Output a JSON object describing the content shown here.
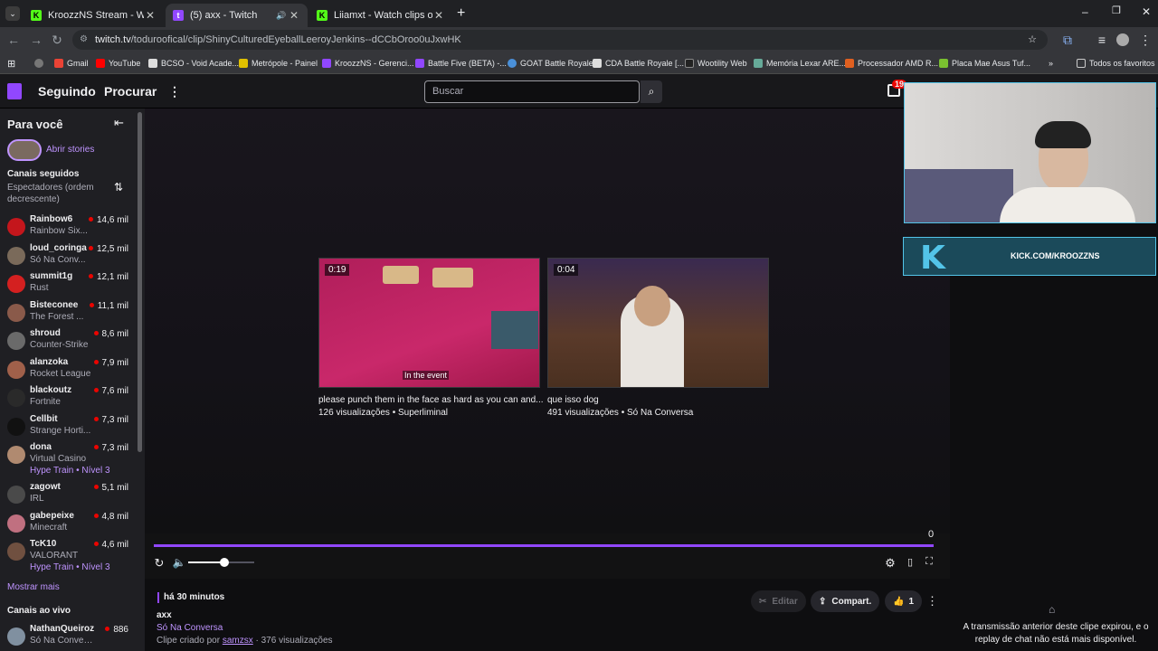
{
  "browser": {
    "tabs": [
      {
        "title": "KroozzNS Stream - Watch Live",
        "favicon": "kick-icon"
      },
      {
        "title": "(5) axx - Twitch",
        "favicon": "twitch-icon"
      },
      {
        "title": "Liiamxt - Watch clips on Kick",
        "favicon": "kick-icon"
      }
    ],
    "url_host": "twitch.tv",
    "url_path": "/toduroofical/clip/ShinyCulturedEyeballLeeroyJenkins--dCCbOroo0uJxwHK",
    "bookmarks": [
      "Gmail",
      "YouTube",
      "BCSO - Void Acade...",
      "Metrópole - Painel",
      "KroozzNS - Gerenci...",
      "Battle Five (BETA) -...",
      "GOAT Battle Royale",
      "CDA Battle Royale [...",
      "Wootility Web",
      "Memória Lexar ARE...",
      "Processador AMD R...",
      "Placa Mae Asus Tuf..."
    ],
    "all_bookmarks": "Todos os favoritos"
  },
  "nav": {
    "following": "Seguindo",
    "browse": "Procurar",
    "search_placeholder": "Buscar",
    "badge": "19"
  },
  "sidebar": {
    "for_you": "Para você",
    "stories": "Abrir stories",
    "followed": "Canais seguidos",
    "sort": "Espectadores (ordem decrescente)",
    "channels": [
      {
        "name": "Rainbow6",
        "game": "Rainbow Six...",
        "viewers": "14,6 mil",
        "color": "#c4161c"
      },
      {
        "name": "loud_coringa",
        "game": "Só Na Conv...",
        "viewers": "12,5 mil",
        "color": "#7a6a5a"
      },
      {
        "name": "summit1g",
        "game": "Rust",
        "viewers": "12,1 mil",
        "color": "#d42020"
      },
      {
        "name": "Bisteconee",
        "game": "The Forest ...",
        "viewers": "11,1 mil",
        "color": "#8a5a4a"
      },
      {
        "name": "shroud",
        "game": "Counter-Strike",
        "viewers": "8,6 mil",
        "color": "#6a6a6a"
      },
      {
        "name": "alanzoka",
        "game": "Rocket League",
        "viewers": "7,9 mil",
        "color": "#a0604a"
      },
      {
        "name": "blackoutz",
        "game": "Fortnite",
        "viewers": "7,6 mil",
        "color": "#2a2a2a"
      },
      {
        "name": "Cellbit",
        "game": "Strange Horti...",
        "viewers": "7,3 mil",
        "color": "#111111"
      },
      {
        "name": "dona",
        "game": "Virtual Casino",
        "viewers": "7,3 mil",
        "color": "#b08a70",
        "hype": "Hype Train • Nível 3"
      },
      {
        "name": "zagowt",
        "game": "IRL",
        "viewers": "5,1 mil",
        "color": "#4a4a4a"
      },
      {
        "name": "gabepeixe",
        "game": "Minecraft",
        "viewers": "4,8 mil",
        "color": "#c07080"
      },
      {
        "name": "TcK10",
        "game": "VALORANT",
        "viewers": "4,6 mil",
        "color": "#705040",
        "hype": "Hype Train • Nível 3"
      }
    ],
    "show_more": "Mostrar mais",
    "live_channels": "Canais ao vivo",
    "live": [
      {
        "name": "NathanQueiroz",
        "game": "Só Na Conversa",
        "viewers": "886",
        "color": "#8090a0"
      }
    ]
  },
  "player": {
    "clips": [
      {
        "duration": "0:19",
        "title": "please punch them in the face as hard as you can and...",
        "meta": "126 visualizações • Superliminal",
        "caption": "In the event"
      },
      {
        "duration": "0:04",
        "title": "que isso dog",
        "meta": "491 visualizações • Só Na Conversa"
      }
    ],
    "counter": "0",
    "volume": 0.55
  },
  "clip_info": {
    "time_ago": "há 30 minutos",
    "title": "axx",
    "category": "Só Na Conversa",
    "created_prefix": "Clipe criado por",
    "creator": "samzsx",
    "views": "· 376 visualizações",
    "edit": "Editar",
    "share": "Compart.",
    "likes": "1"
  },
  "overlay": {
    "kick_url": "KICK.COM/KROOZZNS"
  },
  "chat": {
    "expired": "A transmissão anterior deste clipe expirou, e o replay de chat não está mais disponível."
  },
  "colors": {
    "accent": "#9147ff",
    "kick": "#53fc18",
    "live": "#eb0400"
  }
}
